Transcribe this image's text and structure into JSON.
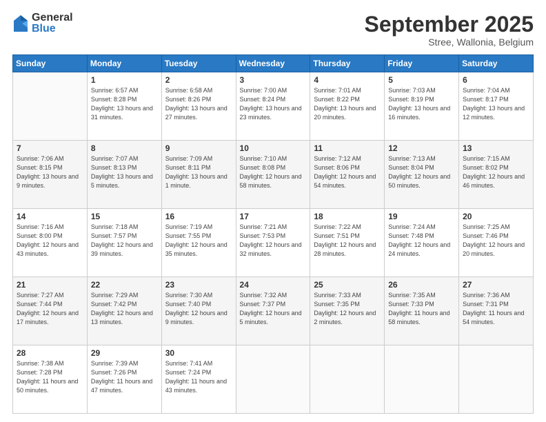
{
  "logo": {
    "general": "General",
    "blue": "Blue"
  },
  "header": {
    "title": "September 2025",
    "subtitle": "Stree, Wallonia, Belgium"
  },
  "days_of_week": [
    "Sunday",
    "Monday",
    "Tuesday",
    "Wednesday",
    "Thursday",
    "Friday",
    "Saturday"
  ],
  "weeks": [
    [
      {
        "day": "",
        "info": ""
      },
      {
        "day": "1",
        "info": "Sunrise: 6:57 AM\nSunset: 8:28 PM\nDaylight: 13 hours and 31 minutes."
      },
      {
        "day": "2",
        "info": "Sunrise: 6:58 AM\nSunset: 8:26 PM\nDaylight: 13 hours and 27 minutes."
      },
      {
        "day": "3",
        "info": "Sunrise: 7:00 AM\nSunset: 8:24 PM\nDaylight: 13 hours and 23 minutes."
      },
      {
        "day": "4",
        "info": "Sunrise: 7:01 AM\nSunset: 8:22 PM\nDaylight: 13 hours and 20 minutes."
      },
      {
        "day": "5",
        "info": "Sunrise: 7:03 AM\nSunset: 8:19 PM\nDaylight: 13 hours and 16 minutes."
      },
      {
        "day": "6",
        "info": "Sunrise: 7:04 AM\nSunset: 8:17 PM\nDaylight: 13 hours and 12 minutes."
      }
    ],
    [
      {
        "day": "7",
        "info": "Sunrise: 7:06 AM\nSunset: 8:15 PM\nDaylight: 13 hours and 9 minutes."
      },
      {
        "day": "8",
        "info": "Sunrise: 7:07 AM\nSunset: 8:13 PM\nDaylight: 13 hours and 5 minutes."
      },
      {
        "day": "9",
        "info": "Sunrise: 7:09 AM\nSunset: 8:11 PM\nDaylight: 13 hours and 1 minute."
      },
      {
        "day": "10",
        "info": "Sunrise: 7:10 AM\nSunset: 8:08 PM\nDaylight: 12 hours and 58 minutes."
      },
      {
        "day": "11",
        "info": "Sunrise: 7:12 AM\nSunset: 8:06 PM\nDaylight: 12 hours and 54 minutes."
      },
      {
        "day": "12",
        "info": "Sunrise: 7:13 AM\nSunset: 8:04 PM\nDaylight: 12 hours and 50 minutes."
      },
      {
        "day": "13",
        "info": "Sunrise: 7:15 AM\nSunset: 8:02 PM\nDaylight: 12 hours and 46 minutes."
      }
    ],
    [
      {
        "day": "14",
        "info": "Sunrise: 7:16 AM\nSunset: 8:00 PM\nDaylight: 12 hours and 43 minutes."
      },
      {
        "day": "15",
        "info": "Sunrise: 7:18 AM\nSunset: 7:57 PM\nDaylight: 12 hours and 39 minutes."
      },
      {
        "day": "16",
        "info": "Sunrise: 7:19 AM\nSunset: 7:55 PM\nDaylight: 12 hours and 35 minutes."
      },
      {
        "day": "17",
        "info": "Sunrise: 7:21 AM\nSunset: 7:53 PM\nDaylight: 12 hours and 32 minutes."
      },
      {
        "day": "18",
        "info": "Sunrise: 7:22 AM\nSunset: 7:51 PM\nDaylight: 12 hours and 28 minutes."
      },
      {
        "day": "19",
        "info": "Sunrise: 7:24 AM\nSunset: 7:48 PM\nDaylight: 12 hours and 24 minutes."
      },
      {
        "day": "20",
        "info": "Sunrise: 7:25 AM\nSunset: 7:46 PM\nDaylight: 12 hours and 20 minutes."
      }
    ],
    [
      {
        "day": "21",
        "info": "Sunrise: 7:27 AM\nSunset: 7:44 PM\nDaylight: 12 hours and 17 minutes."
      },
      {
        "day": "22",
        "info": "Sunrise: 7:29 AM\nSunset: 7:42 PM\nDaylight: 12 hours and 13 minutes."
      },
      {
        "day": "23",
        "info": "Sunrise: 7:30 AM\nSunset: 7:40 PM\nDaylight: 12 hours and 9 minutes."
      },
      {
        "day": "24",
        "info": "Sunrise: 7:32 AM\nSunset: 7:37 PM\nDaylight: 12 hours and 5 minutes."
      },
      {
        "day": "25",
        "info": "Sunrise: 7:33 AM\nSunset: 7:35 PM\nDaylight: 12 hours and 2 minutes."
      },
      {
        "day": "26",
        "info": "Sunrise: 7:35 AM\nSunset: 7:33 PM\nDaylight: 11 hours and 58 minutes."
      },
      {
        "day": "27",
        "info": "Sunrise: 7:36 AM\nSunset: 7:31 PM\nDaylight: 11 hours and 54 minutes."
      }
    ],
    [
      {
        "day": "28",
        "info": "Sunrise: 7:38 AM\nSunset: 7:28 PM\nDaylight: 11 hours and 50 minutes."
      },
      {
        "day": "29",
        "info": "Sunrise: 7:39 AM\nSunset: 7:26 PM\nDaylight: 11 hours and 47 minutes."
      },
      {
        "day": "30",
        "info": "Sunrise: 7:41 AM\nSunset: 7:24 PM\nDaylight: 11 hours and 43 minutes."
      },
      {
        "day": "",
        "info": ""
      },
      {
        "day": "",
        "info": ""
      },
      {
        "day": "",
        "info": ""
      },
      {
        "day": "",
        "info": ""
      }
    ]
  ]
}
